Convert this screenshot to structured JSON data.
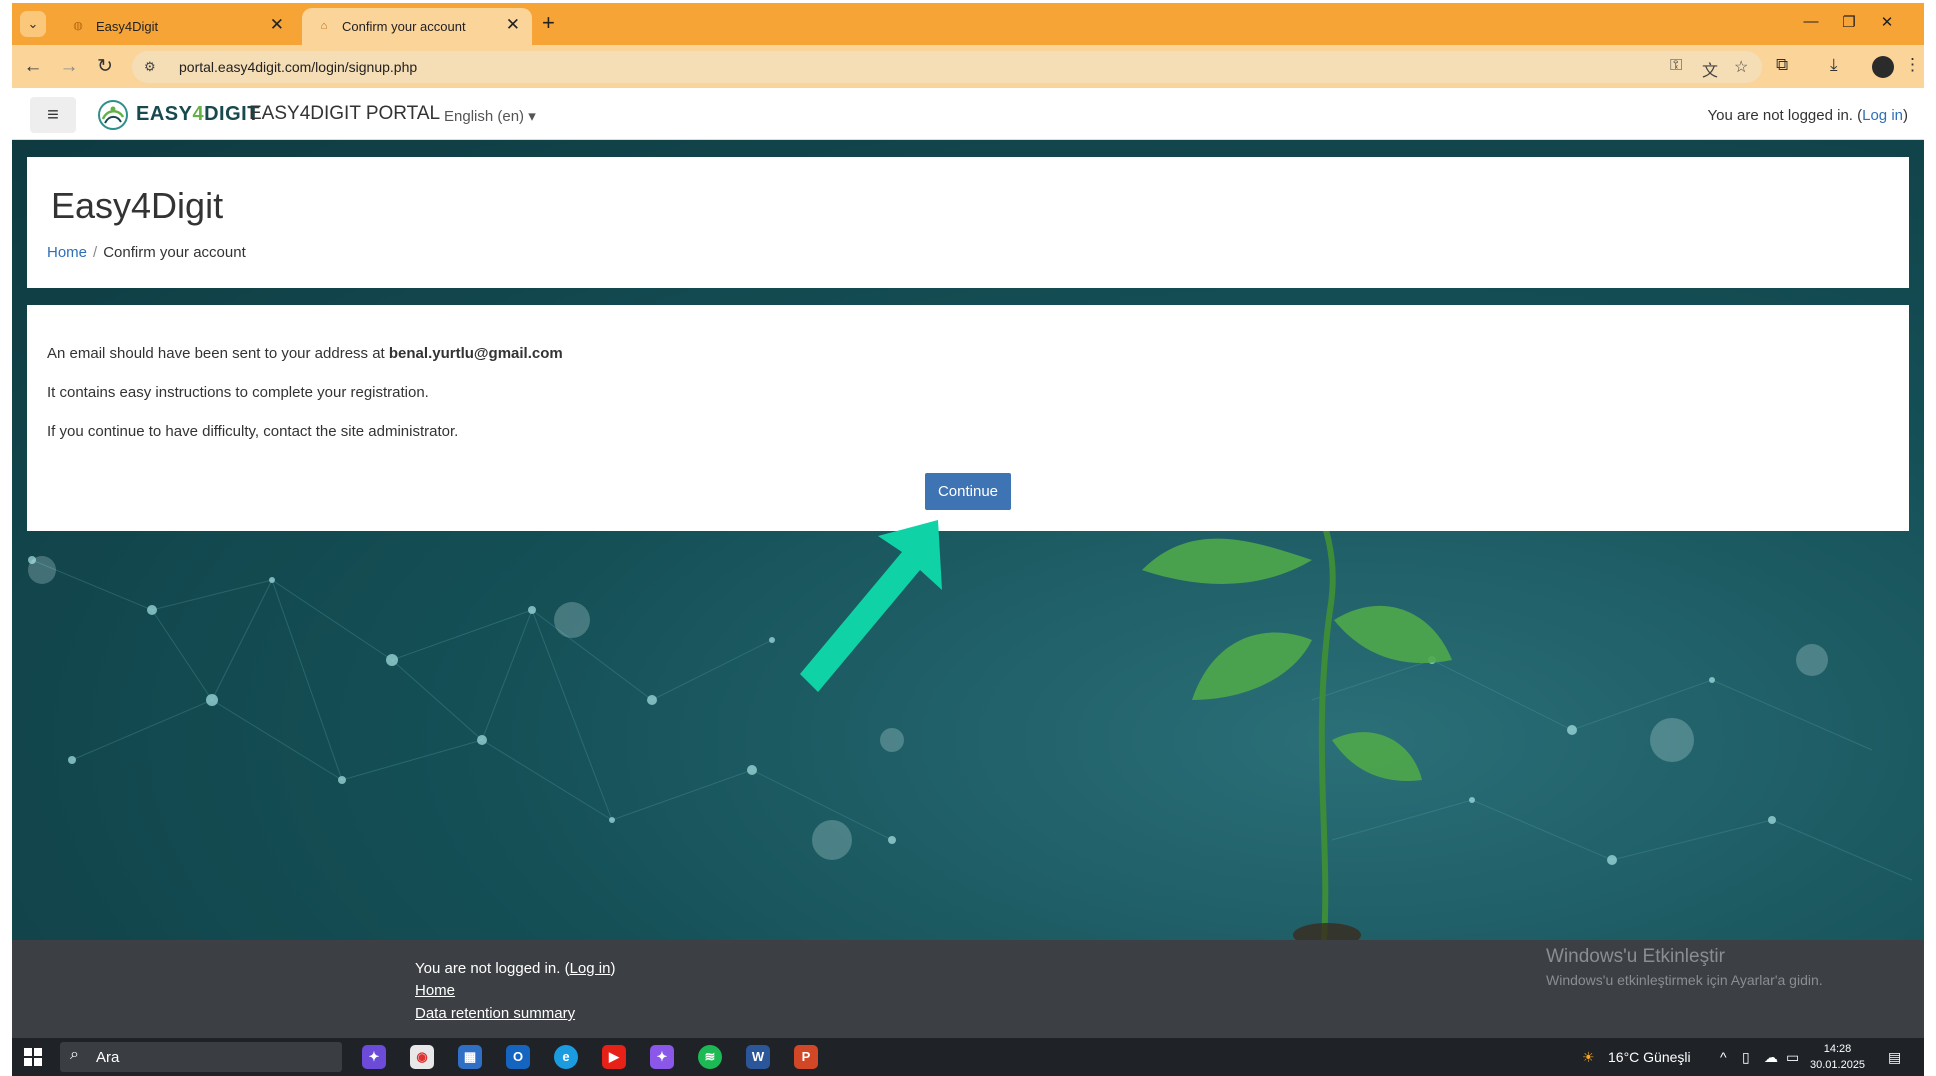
{
  "browser": {
    "tabs": [
      {
        "title": "Easy4Digit",
        "active": false
      },
      {
        "title": "Confirm your account",
        "active": true
      }
    ],
    "url": "portal.easy4digit.com/login/signup.php"
  },
  "site": {
    "brand_prefix": "EASY",
    "brand_four": "4",
    "brand_suffix": "DIGIT",
    "portal_name": "EASY4DIGIT PORTAL",
    "language": "English (en)",
    "login_status_text": "You are not logged in. (",
    "login_link": "Log in",
    "login_status_close": ")"
  },
  "page": {
    "title": "Easy4Digit",
    "breadcrumb": {
      "home": "Home",
      "current": "Confirm your account"
    },
    "email_intro": "An email should have been sent to your address at",
    "email": "benal.yurtlu@gmail.com",
    "instructions": "It contains easy instructions to complete your registration.",
    "difficulty": "If you continue to have difficulty, contact the site administrator.",
    "continue_button": "Continue"
  },
  "footer": {
    "not_logged": "You are not logged in. (",
    "login_link": "Log in",
    "close": ")",
    "home": "Home",
    "data_retention": "Data retention summary"
  },
  "watermark": {
    "title": "Windows'u Etkinleştir",
    "subtitle": "Windows'u etkinleştirmek için Ayarlar'a gidin."
  },
  "taskbar": {
    "search_placeholder": "Ara",
    "weather": "16°C  Güneşli",
    "time": "14:28",
    "date": "30.01.2025"
  },
  "colors": {
    "chrome_accent": "#f7a437",
    "site_background": "#155057",
    "button": "#3e73b4",
    "arrow": "#0fd3a6",
    "footer": "#3c3f43"
  }
}
